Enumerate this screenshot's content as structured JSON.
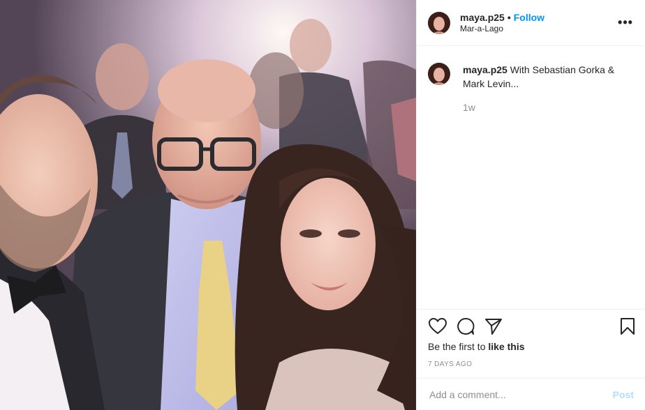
{
  "header": {
    "username": "maya.p25",
    "separator": "•",
    "follow_label": "Follow",
    "location": "Mar-a-Lago",
    "more_icon": "more-horizontal-icon"
  },
  "caption": {
    "username": "maya.p25",
    "text": "With Sebastian Gorka & Mark Levin...",
    "time_ago": "1w"
  },
  "actions": {
    "like_icon": "heart-icon",
    "comment_icon": "comment-icon",
    "share_icon": "paper-plane-icon",
    "save_icon": "bookmark-icon"
  },
  "likes": {
    "prefix": "Be the first to ",
    "link": "like this"
  },
  "date": "7 DAYS AGO",
  "comment": {
    "placeholder": "Add a comment...",
    "post_label": "Post"
  },
  "colors": {
    "follow": "#0095f6",
    "post_disabled": "#b2dffc",
    "muted": "#8e8e8e"
  }
}
